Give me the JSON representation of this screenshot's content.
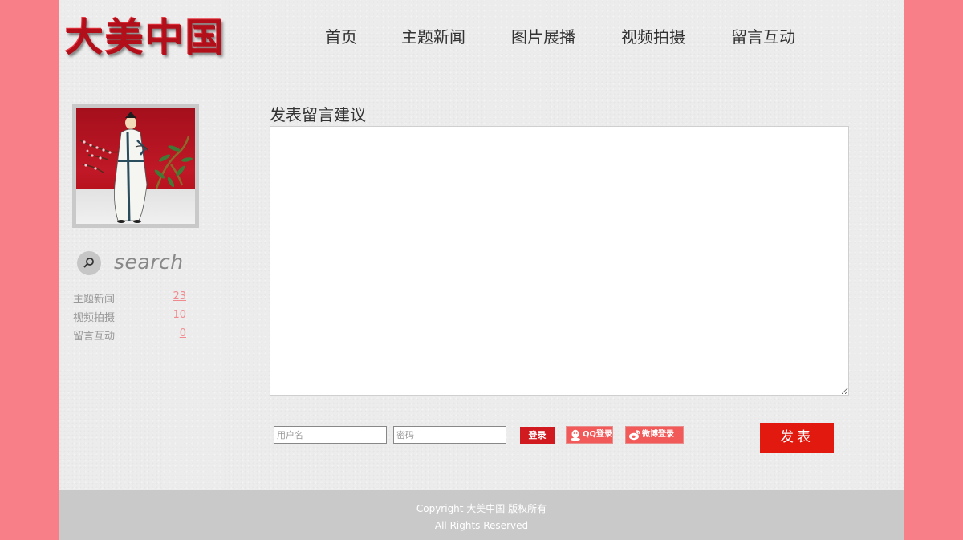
{
  "logo": {
    "text": "大美中国",
    "color": "#b30f1a"
  },
  "nav": {
    "items": [
      {
        "label": "首页"
      },
      {
        "label": "主题新闻"
      },
      {
        "label": "图片展播"
      },
      {
        "label": "视频拍摄"
      },
      {
        "label": "留言互动"
      }
    ]
  },
  "sidebar": {
    "avatar": {
      "icon": "scholar-portrait-image"
    },
    "search": {
      "placeholder": "search",
      "icon": "search-icon"
    },
    "categories": [
      {
        "label": "主题新闻",
        "count": "23"
      },
      {
        "label": "视频拍摄",
        "count": "10"
      },
      {
        "label": "留言互动",
        "count": "0"
      }
    ]
  },
  "main": {
    "title": "发表留言建议",
    "message_value": ""
  },
  "login": {
    "username_placeholder": "用户名",
    "password_placeholder": "密码",
    "login_label": "登录",
    "qq_label": "QQ登录",
    "weibo_label": "微博登录",
    "submit_label": "发表"
  },
  "footer": {
    "line1": "Copyright 大美中国 版权所有",
    "line2": "All Rights Reserved"
  },
  "colors": {
    "outer_background": "#f87f87",
    "page_background": "#ececec",
    "accent_red": "#e2190f",
    "footer_background": "#c9c9c9",
    "count_link": "#f08a8f"
  }
}
